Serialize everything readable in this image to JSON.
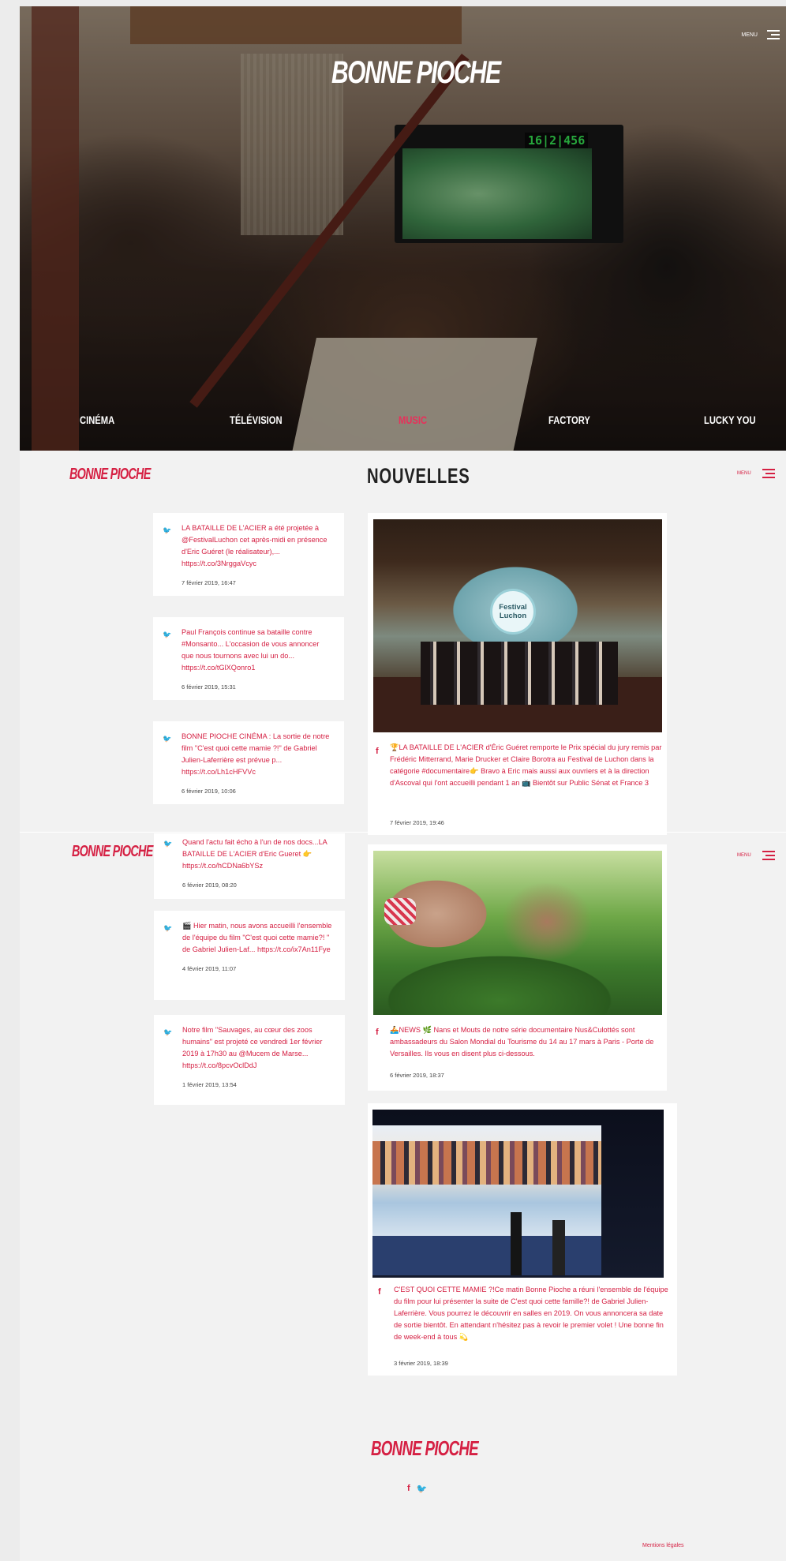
{
  "hero": {
    "logo": "BONNE PIOCHE",
    "timecode": "16|2|456",
    "menu_label": "MENU",
    "nav": [
      "CINÉMA",
      "TÉLÉVISION",
      "MUSIC",
      "FACTORY",
      "LUCKY YOU"
    ],
    "active_nav": "MUSIC"
  },
  "brand": "BONNE PIOCHE",
  "section_title": "NOUVELLES",
  "menu_label": "MENU",
  "tweets": [
    {
      "text": "LA BATAILLE DE L'ACIER a été projetée à @FestivalLuchon cet après-midi en présence d'Eric Guéret (le réalisateur),... https://t.co/3NrggaVcyc",
      "date": "7 février 2019, 16:47"
    },
    {
      "text": "Paul François continue sa bataille contre #Monsanto... L'occasion de vous annoncer que nous tournons avec lui un do... https://t.co/tGlXQonro1",
      "date": "6 février 2019, 15:31"
    },
    {
      "text": "BONNE PIOCHE CINÉMA : La sortie de notre film \"C'est quoi cette mamie ?!\" de Gabriel Julien-Laferrière est prévue p... https://t.co/Lh1cHFVVc",
      "date": "6 février 2019, 10:06"
    },
    {
      "text": "Quand l'actu fait écho à l'un de nos docs...LA BATAILLE DE L'ACIER d'Eric Gueret 👉 https://t.co/hCDNa6bYSz",
      "date": "6 février 2019, 08:20"
    },
    {
      "text": "🎬 Hier matin, nous avons accueilli l'ensemble de l'équipe du film \"C'est quoi cette mamie?! \" de Gabriel Julien-Laf... https://t.co/ix7An11Fye",
      "date": "4 février 2019, 11:07"
    },
    {
      "text": "Notre film \"Sauvages, au cœur des zoos humains\" est projeté ce vendredi 1er février 2019 à 17h30 au @Mucem de Marse... https://t.co/8pcvOclDdJ",
      "date": "1 février 2019, 13:54"
    }
  ],
  "fb_posts": [
    {
      "badge": "Festival Luchon",
      "text": "🏆LA BATAILLE DE L'ACIER d'Éric Guéret remporte le Prix spécial du jury remis par Frédéric Mitterrand, Marie Drucker et Claire Borotra au Festival de Luchon dans la catégorie #documentaire👉 Bravo à Eric mais aussi aux ouvriers et à la direction d'Ascoval qui l'ont accueilli pendant 1 an 📺 Bientôt sur Public Sénat et France 3",
      "date": "7 février 2019, 19:46"
    },
    {
      "text": "🚣NEWS 🌿 Nans et Mouts de notre série documentaire Nus&Culottés sont ambassadeurs du Salon Mondial du Tourisme du 14 au 17 mars à Paris - Porte de Versailles. Ils vous en disent plus ci-dessous.",
      "date": "6 février 2019, 18:37"
    },
    {
      "text": "C'EST QUOI CETTE MAMIE ?!Ce matin Bonne Pioche a réuni l'ensemble de l'équipe du film pour lui présenter la suite de C'est quoi cette famille?! de Gabriel Julien-Laferrière. Vous pourrez le découvrir en salles en 2019. On vous annoncera sa date de sortie bientôt. En attendant n'hésitez pas à revoir le premier volet ! Une bonne fin de week-end à tous 💫",
      "date": "3 février 2019, 18:39"
    }
  ],
  "footer": {
    "logo": "BONNE PIOCHE",
    "social": [
      "f",
      "🐦"
    ],
    "legal": "Mentions légales"
  },
  "colors": {
    "accent": "#d52043",
    "bg": "#f2f2f2"
  },
  "icons": {
    "twitter": "twitter-icon",
    "facebook": "facebook-icon",
    "menu": "hamburger-icon"
  }
}
